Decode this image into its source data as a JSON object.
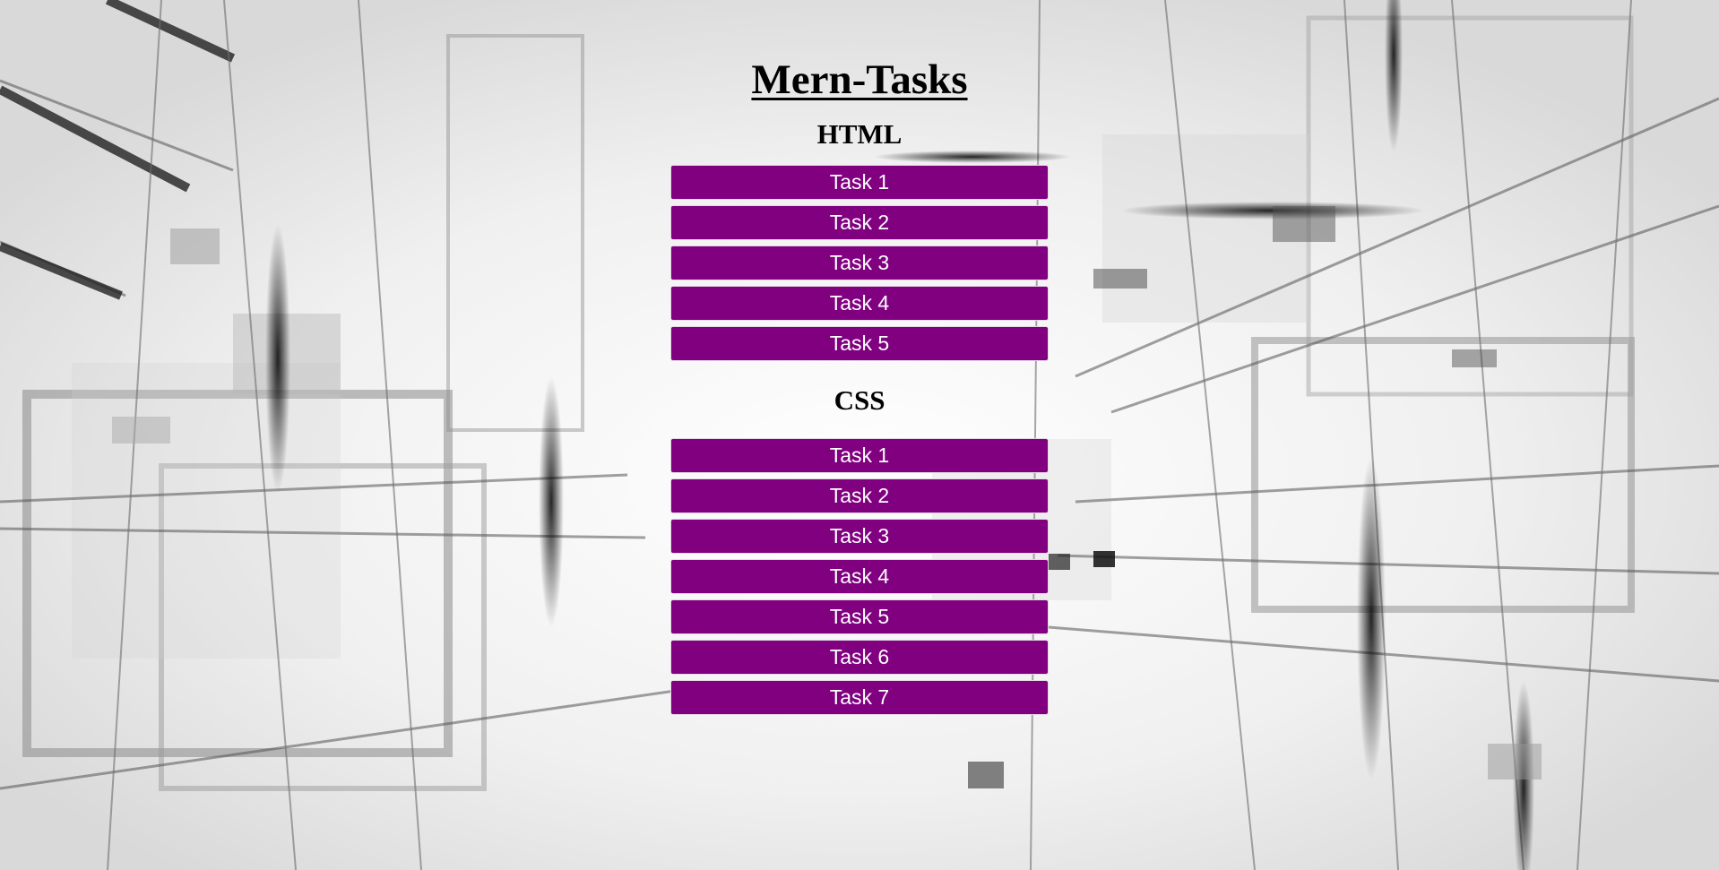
{
  "page": {
    "title": "Mern-Tasks",
    "background_image": "abstract-geometric-lines",
    "accent_color": "#800080"
  },
  "sections": [
    {
      "title": "HTML",
      "tasks": [
        "Task 1",
        "Task 2",
        "Task 3",
        "Task 4",
        "Task 5"
      ]
    },
    {
      "title": "CSS",
      "tasks": [
        "Task 1",
        "Task 2",
        "Task 3",
        "Task 4",
        "Task 5",
        "Task 6",
        "Task 7"
      ]
    }
  ]
}
